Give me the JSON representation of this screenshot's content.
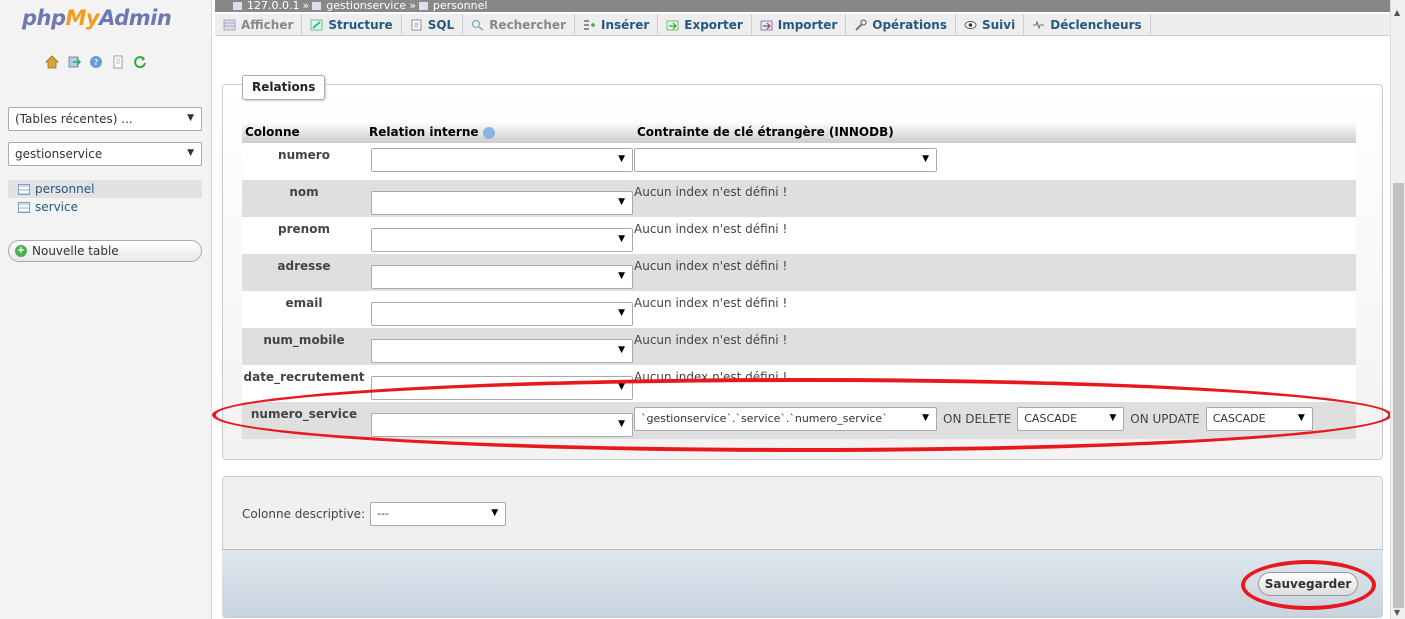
{
  "sidebar": {
    "logo": {
      "php": "php",
      "my": "My",
      "admin": "Admin"
    },
    "quick_icons": [
      "home-icon",
      "logout-icon",
      "help-icon",
      "docs-icon",
      "reload-icon"
    ],
    "recent_tables": "(Tables récentes) ...",
    "database": "gestionservice",
    "tables": [
      "personnel",
      "service"
    ],
    "new_table": "Nouvelle table"
  },
  "breadcrumb": {
    "server": "127.0.0.1",
    "sep": "»",
    "database": "gestionservice",
    "table": "personnel"
  },
  "tabs": [
    {
      "label": "Afficher",
      "icon": "browse-icon",
      "disabled": true
    },
    {
      "label": "Structure",
      "icon": "structure-icon",
      "disabled": false
    },
    {
      "label": "SQL",
      "icon": "sql-icon",
      "disabled": false
    },
    {
      "label": "Rechercher",
      "icon": "search-icon",
      "disabled": true
    },
    {
      "label": "Insérer",
      "icon": "insert-icon",
      "disabled": false
    },
    {
      "label": "Exporter",
      "icon": "export-icon",
      "disabled": false
    },
    {
      "label": "Importer",
      "icon": "import-icon",
      "disabled": false
    },
    {
      "label": "Opérations",
      "icon": "wrench-icon",
      "disabled": false
    },
    {
      "label": "Suivi",
      "icon": "eye-icon",
      "disabled": false
    },
    {
      "label": "Déclencheurs",
      "icon": "trigger-icon",
      "disabled": false
    }
  ],
  "relations": {
    "legend": "Relations",
    "headers": {
      "column": "Colonne",
      "internal": "Relation interne",
      "fk": "Contrainte de clé étrangère (INNODB)"
    },
    "no_index": "Aucun index n'est défini !",
    "rows": [
      {
        "name": "numero"
      },
      {
        "name": "nom"
      },
      {
        "name": "prenom"
      },
      {
        "name": "adresse"
      },
      {
        "name": "email"
      },
      {
        "name": "num_mobile"
      },
      {
        "name": "date_recrutement"
      },
      {
        "name": "numero_service"
      }
    ],
    "fk": {
      "target": "`gestionservice`.`service`.`numero_service`",
      "on_delete_label": "ON DELETE",
      "on_delete": "CASCADE",
      "on_update_label": "ON UPDATE",
      "on_update": "CASCADE"
    }
  },
  "descriptive": {
    "label": "Colonne descriptive:",
    "value": "---"
  },
  "save_label": "Sauvegarder",
  "colors": {
    "annotation": "#e8191e",
    "link": "#235a81"
  }
}
